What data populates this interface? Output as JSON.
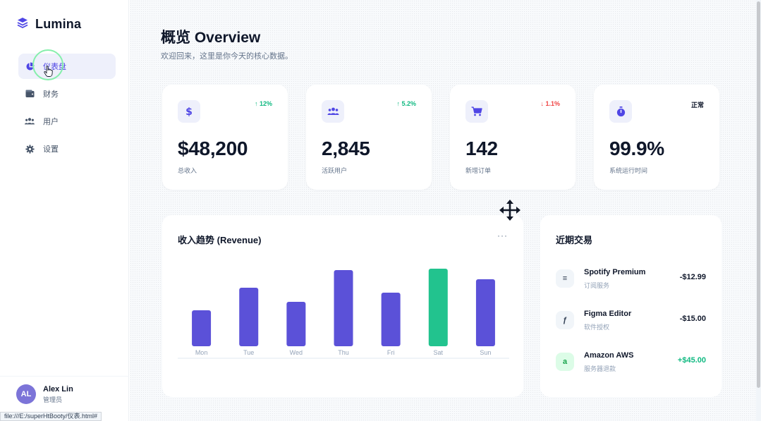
{
  "app": {
    "name": "Lumina"
  },
  "sidebar": {
    "items": [
      {
        "label": "仪表盘",
        "icon": "pie-chart-icon",
        "active": true
      },
      {
        "label": "财务",
        "icon": "wallet-icon",
        "active": false
      },
      {
        "label": "用户",
        "icon": "users-icon",
        "active": false
      },
      {
        "label": "设置",
        "icon": "gear-icon",
        "active": false
      }
    ],
    "user": {
      "initials": "AL",
      "name": "Alex Lin",
      "role": "管理员"
    }
  },
  "status_url": "file:///E:/superHtBooty/仪表.html#",
  "header": {
    "title": "概览 Overview",
    "subtitle": "欢迎回来，这里是你今天的核心数据。"
  },
  "stats": [
    {
      "icon": "dollar-icon",
      "trend": "↑ 12%",
      "trend_dir": "up",
      "value": "$48,200",
      "label": "总收入"
    },
    {
      "icon": "users-icon",
      "trend": "↑ 5.2%",
      "trend_dir": "up",
      "value": "2,845",
      "label": "活跃用户"
    },
    {
      "icon": "cart-icon",
      "trend": "↓ 1.1%",
      "trend_dir": "down",
      "value": "142",
      "label": "新增订单"
    },
    {
      "icon": "stopwatch-icon",
      "trend": "正常",
      "trend_dir": "neutral",
      "value": "99.9%",
      "label": "系统运行时间"
    }
  ],
  "revenue_chart": {
    "title": "收入趋势 (Revenue)",
    "menu": "···"
  },
  "chart_data": {
    "type": "bar",
    "categories": [
      "Mon",
      "Tue",
      "Wed",
      "Thu",
      "Fri",
      "Sat",
      "Sun"
    ],
    "values": [
      51,
      83,
      63,
      108,
      76,
      110,
      95
    ],
    "highlight_index": 5,
    "colors": {
      "bar": "#5b51d8",
      "highlight": "#22c38e"
    },
    "title": "收入趋势 (Revenue)",
    "xlabel": "",
    "ylabel": "",
    "ylim": [
      0,
      120
    ],
    "grid": false
  },
  "transactions": {
    "title": "近期交易",
    "items": [
      {
        "icon": "spotify-icon",
        "glyph": "≡",
        "name": "Spotify Premium",
        "sub": "订阅服务",
        "amount": "-$12.99",
        "positive": false
      },
      {
        "icon": "figma-icon",
        "glyph": "ƒ",
        "name": "Figma Editor",
        "sub": "软件授权",
        "amount": "-$15.00",
        "positive": false
      },
      {
        "icon": "amazon-icon",
        "glyph": "a",
        "name": "Amazon AWS",
        "sub": "服务器退款",
        "amount": "+$45.00",
        "positive": true
      }
    ]
  },
  "theme": {
    "accent": "#4f46e5",
    "success": "#10b981",
    "danger": "#ef4444"
  }
}
